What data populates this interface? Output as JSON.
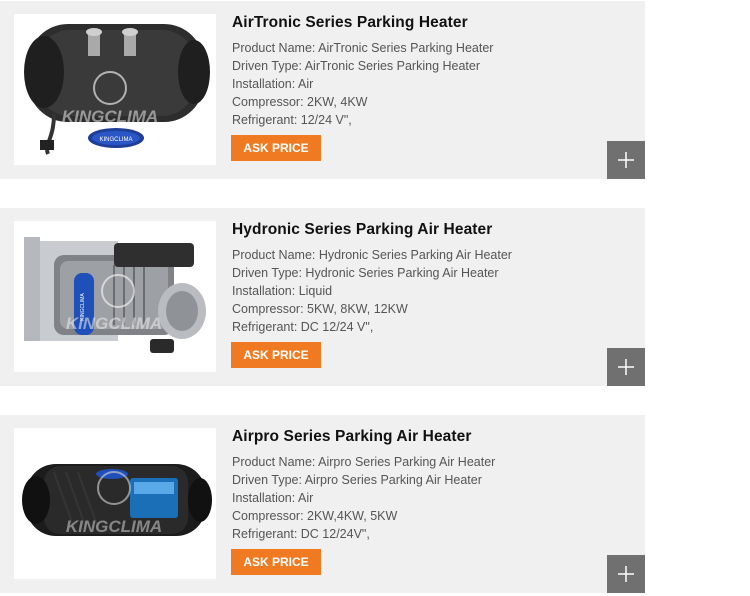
{
  "products": [
    {
      "title": "AirTronic Series Parking Heater",
      "specs": [
        "Product Name: AirTronic Series Parking Heater",
        "Driven Type: AirTronic Series Parking Heater",
        "Installation: Air",
        "Compressor: 2KW, 4KW",
        "Refrigerant: 12/24 V\","
      ],
      "button": "ASK PRICE",
      "watermark": "KINGCLIMA"
    },
    {
      "title": "Hydronic Series Parking Air Heater",
      "specs": [
        "Product Name: Hydronic Series Parking Air Heater",
        "Driven Type: Hydronic Series Parking Air Heater",
        "Installation: Liquid",
        "Compressor: 5KW, 8KW, 12KW",
        "Refrigerant: DC 12/24 V\","
      ],
      "button": "ASK PRICE",
      "watermark": "KINGCLIMA"
    },
    {
      "title": "Airpro Series Parking Air Heater",
      "specs": [
        "Product Name: Airpro Series Parking Air Heater",
        "Driven Type: Airpro Series Parking Air Heater",
        "Installation: Air",
        "Compressor: 2KW,4KW, 5KW",
        "Refrigerant: DC 12/24V\","
      ],
      "button": "ASK PRICE",
      "watermark": "KINGCLIMA"
    }
  ],
  "colors": {
    "card_bg": "#f0f0f0",
    "button_bg": "#f07a22",
    "plus_bg": "#707070"
  },
  "icons": {
    "expand": "plus-icon"
  }
}
